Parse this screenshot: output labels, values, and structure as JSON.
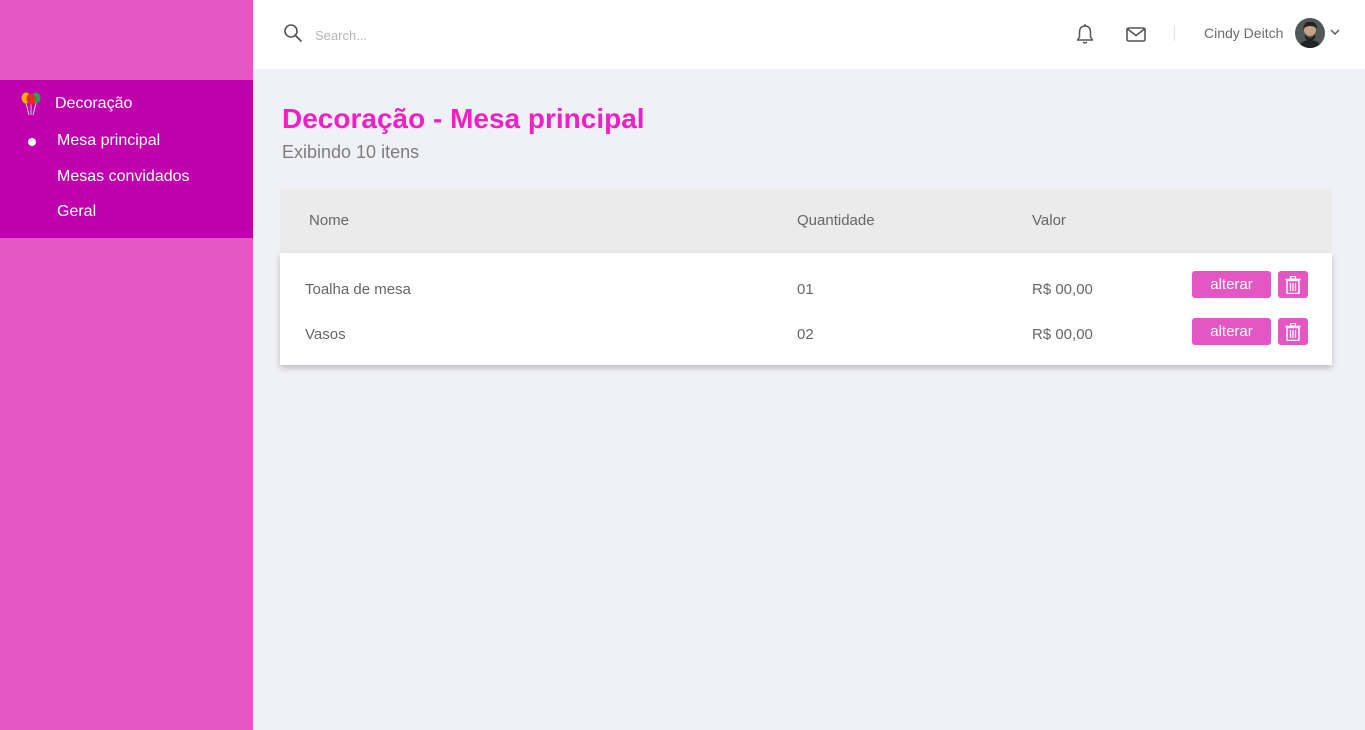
{
  "sidebar": {
    "menu_label": "Decoração",
    "items": [
      {
        "label": "Mesa principal",
        "active": true
      },
      {
        "label": "Mesas convidados",
        "active": false
      },
      {
        "label": "Geral",
        "active": false
      }
    ]
  },
  "topbar": {
    "search_placeholder": "Search...",
    "user_name": "Cindy Deitch"
  },
  "page": {
    "title_strong": "Decoração",
    "title_sep": " - ",
    "title_light": "Mesa principal",
    "subtitle": "Exibindo 10 itens"
  },
  "table": {
    "columns": [
      "Nome",
      "Quantidade",
      "Valor"
    ],
    "rows": [
      {
        "nome": "Toalha de mesa",
        "quantidade": "01",
        "valor": "R$ 00,00",
        "edit_label": "alterar"
      },
      {
        "nome": "Vasos",
        "quantidade": "02",
        "valor": "R$ 00,00",
        "edit_label": "alterar"
      }
    ]
  },
  "colors": {
    "sidebar_bg": "#e356c3",
    "menu_bg": "#c000ad",
    "accent": "#f01fc6",
    "button_bg": "#e356c3"
  },
  "icons": [
    "balloons-icon",
    "search-icon",
    "bell-icon",
    "mail-icon",
    "chevron-down-icon",
    "trash-icon"
  ]
}
